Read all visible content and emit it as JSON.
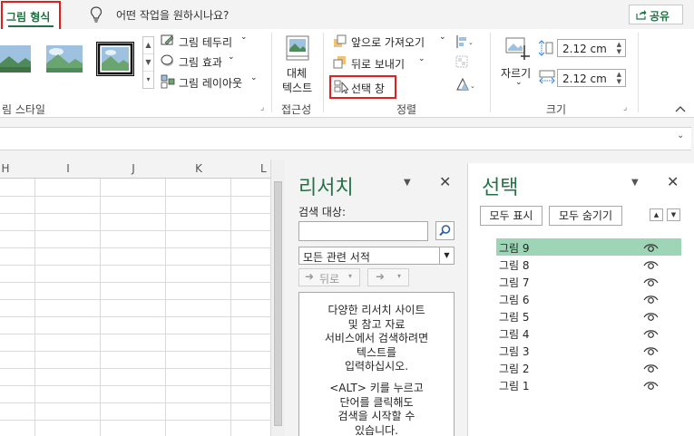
{
  "tabs": {
    "active": "그림 형식",
    "tell_me": "어떤 작업을 원하시나요?",
    "share": "공유"
  },
  "ribbon": {
    "styles_group": "림 스타일",
    "border": "그림 테두리",
    "effects": "그림 효과",
    "layout": "그림 레이아웃",
    "alt_text_line1": "대체",
    "alt_text_line2": "텍스트",
    "accessibility_group": "접근성",
    "bring_forward": "앞으로 가져오기",
    "send_backward": "뒤로 보내기",
    "selection_pane": "선택 창",
    "arrange_group": "정렬",
    "crop": "자르기",
    "height": "2.12 cm",
    "width": "2.12 cm",
    "size_group": "크기"
  },
  "grid": {
    "columns": [
      "H",
      "I",
      "J",
      "K",
      "L"
    ]
  },
  "research": {
    "title": "리서치",
    "search_label": "검색 대상:",
    "search_value": "",
    "source": "모든 관련 서적",
    "back": "뒤로",
    "info1": [
      "다양한 리서치 사이트",
      "및 참고 자료",
      "서비스에서 검색하려면",
      "텍스트를",
      "입력하십시오."
    ],
    "info2": [
      "<ALT> 키를 누르고",
      "단어를 클릭해도",
      "검색을 시작할 수",
      "있습니다."
    ]
  },
  "selection": {
    "title": "선택",
    "show_all": "모두 표시",
    "hide_all": "모두 숨기기",
    "items": [
      "그림 9",
      "그림 8",
      "그림 7",
      "그림 6",
      "그림 5",
      "그림 4",
      "그림 3",
      "그림 2",
      "그림 1"
    ],
    "active_item": "그림 9"
  },
  "colors": {
    "accent": "#217346",
    "highlight_box": "#e0201c",
    "selected_row": "#9fd5b7"
  }
}
